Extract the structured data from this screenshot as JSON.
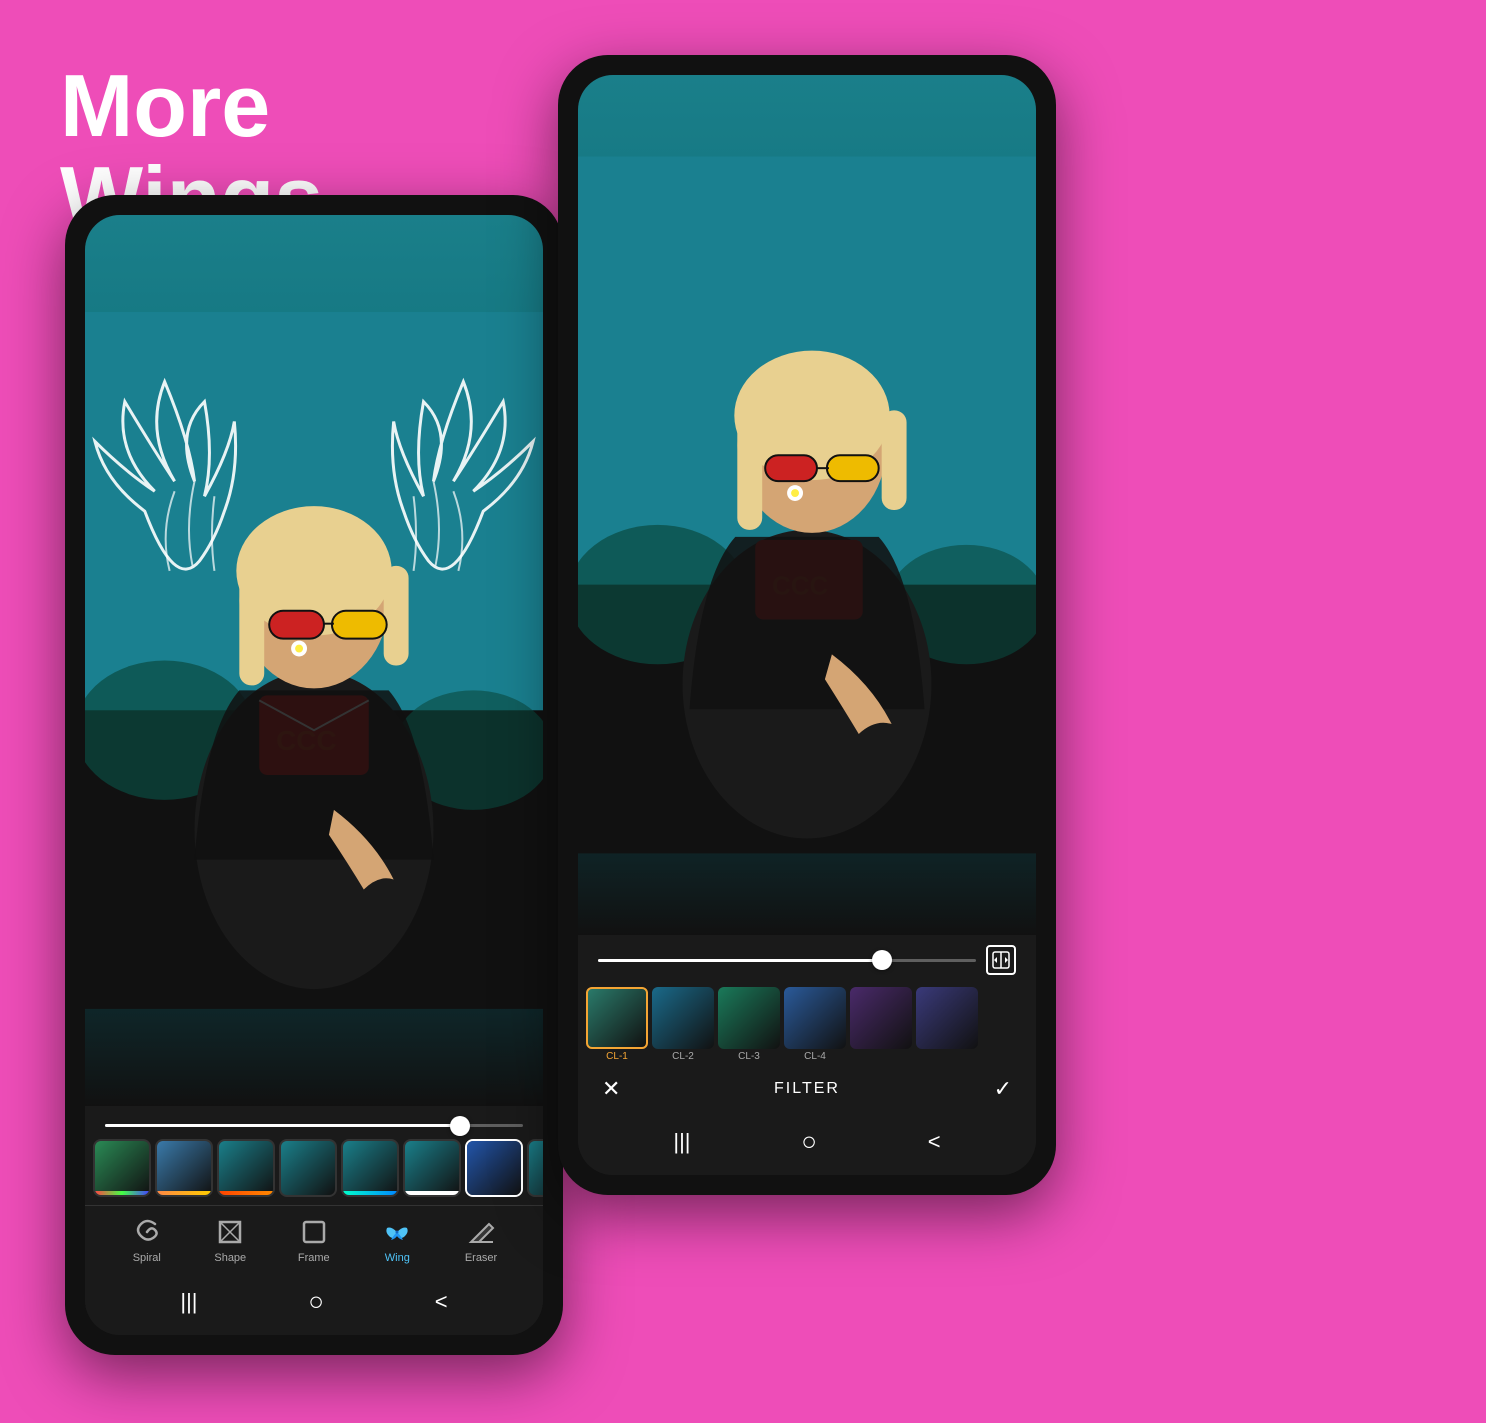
{
  "background": {
    "color": "#ee4db8"
  },
  "title": {
    "line1": "More",
    "line2": "Wings"
  },
  "phone_left": {
    "tools": [
      {
        "id": "spiral",
        "label": "Spiral",
        "icon": "spiral",
        "active": false
      },
      {
        "id": "shape",
        "label": "Shape",
        "icon": "shape",
        "active": false
      },
      {
        "id": "frame",
        "label": "Frame",
        "icon": "frame",
        "active": false
      },
      {
        "id": "wing",
        "label": "Wing",
        "icon": "wing",
        "active": true
      },
      {
        "id": "eraser",
        "label": "Eraser",
        "icon": "eraser",
        "active": false
      }
    ],
    "slider_value": 85,
    "thumbnails_count": 8,
    "nav": [
      "|||",
      "○",
      "<"
    ]
  },
  "phone_right": {
    "filters": [
      {
        "id": "cl1",
        "label": "CL-1",
        "active": true
      },
      {
        "id": "cl2",
        "label": "CL-2",
        "active": false
      },
      {
        "id": "cl3",
        "label": "CL-3",
        "active": false
      },
      {
        "id": "cl4",
        "label": "CL-4",
        "active": false
      },
      {
        "id": "f5",
        "label": "",
        "active": false
      },
      {
        "id": "f6",
        "label": "",
        "active": false
      }
    ],
    "slider_value": 75,
    "filter_label": "FILTER",
    "cancel_icon": "✕",
    "confirm_icon": "✓",
    "nav": [
      "|||",
      "○",
      "<"
    ]
  }
}
